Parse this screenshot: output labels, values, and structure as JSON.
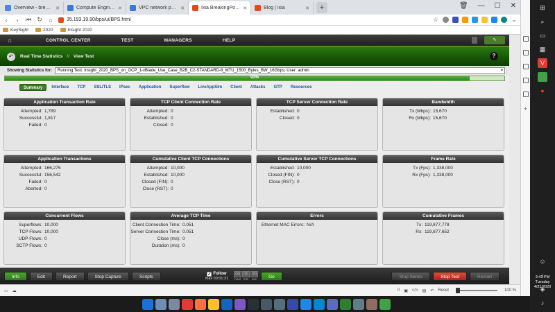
{
  "browser": {
    "tabs": [
      {
        "label": "Overview - breaking... - Dr",
        "color": "#4a86e8",
        "active": false
      },
      {
        "label": "Compute Engine - ixvm -",
        "color": "#3c78d8",
        "active": false
      },
      {
        "label": "VPC network peering - VP",
        "color": "#3c78d8",
        "active": false
      },
      {
        "label": "Ixia BreakingPoint - 35.19:",
        "color": "#e64a19",
        "active": true
      },
      {
        "label": "Blog | Ixia",
        "color": "#e64a19",
        "active": false
      }
    ],
    "new_tab": "+",
    "url": "35.193.19.90/bps/ui/BPS.html",
    "bookmarks": [
      "KeySight",
      "2020",
      "Insight 2020"
    ],
    "zoom": "100 %",
    "reset_label": "Reset"
  },
  "app": {
    "menu": [
      "CONTROL CENTER",
      "TEST",
      "MANAGERS",
      "HELP"
    ],
    "breadcrumb": {
      "section": "Real Time Statistics",
      "separator": "//",
      "page": "View Test"
    },
    "help_icon": "?",
    "stats_label": "Showing Statistics for:",
    "stats_value": "Running Test: Insight_2020_BPS_on_GCP_1-vBlade_Use_Case_B2B_C2-STANDARD-8_MTU_1500_Bytes_BW_16Gbps, User: admin",
    "progress": {
      "text": "93%",
      "value": 0.93
    },
    "subtabs": [
      "Summary",
      "Interface",
      "TCP",
      "SSL/TLS",
      "IPsec",
      "Application",
      "Superflow",
      "LiveAppSim",
      "Client",
      "Attacks",
      "GTP",
      "Resources"
    ],
    "cards": [
      {
        "title": "Application Transaction Rate",
        "rows": [
          {
            "k": "Attempted:",
            "v": "1,789"
          },
          {
            "k": "Successful:",
            "v": "1,817"
          },
          {
            "k": "Failed:",
            "v": "0"
          }
        ]
      },
      {
        "title": "TCP Client Connection Rate",
        "rows": [
          {
            "k": "Attempted:",
            "v": "0"
          },
          {
            "k": "Established:",
            "v": "0"
          },
          {
            "k": "Closed:",
            "v": "0"
          }
        ]
      },
      {
        "title": "TCP Server Connection Rate",
        "rows": [
          {
            "k": "Established:",
            "v": "0"
          },
          {
            "k": "Closed:",
            "v": "0"
          }
        ]
      },
      {
        "title": "Bandwidth",
        "rows": [
          {
            "k": "Tx (Mbps):",
            "v": "15,670"
          },
          {
            "k": "Rx (Mbps):",
            "v": "15,670"
          }
        ]
      },
      {
        "title": "Application Transactions",
        "rows": [
          {
            "k": "Attempted:",
            "v": "166,275"
          },
          {
            "k": "Successful:",
            "v": "156,542"
          },
          {
            "k": "Failed:",
            "v": "0"
          },
          {
            "k": "Aborted:",
            "v": "0"
          }
        ]
      },
      {
        "title": "Cumulative Client TCP Connections",
        "rows": [
          {
            "k": "Attempted:",
            "v": "10,000"
          },
          {
            "k": "Established:",
            "v": "10,000"
          },
          {
            "k": "Closed (FIN):",
            "v": "0"
          },
          {
            "k": "Close (RST):",
            "v": "0"
          }
        ]
      },
      {
        "title": "Cumulative Server TCP Connections",
        "rows": [
          {
            "k": "Established:",
            "v": "10,000"
          },
          {
            "k": "Closed (FIN):",
            "v": "0"
          },
          {
            "k": "Close (RST):",
            "v": "0"
          }
        ]
      },
      {
        "title": "Frame Rate",
        "rows": [
          {
            "k": "Tx (Fps):",
            "v": "1,338,000"
          },
          {
            "k": "Rx (Fps):",
            "v": "1,338,000"
          }
        ]
      },
      {
        "title": "Concurrent Flows",
        "rows": [
          {
            "k": "Superflows:",
            "v": "10,000"
          },
          {
            "k": "TCP Flows:",
            "v": "10,000"
          },
          {
            "k": "UDP Flows:",
            "v": "0"
          },
          {
            "k": "SCTP Flows:",
            "v": "0"
          }
        ]
      },
      {
        "title": "Average TCP Time",
        "rows": [
          {
            "k": "Client Connection Time:",
            "v": "0.051"
          },
          {
            "k": "Server Connection Time:",
            "v": "0.051"
          },
          {
            "k": "Close (ms):",
            "v": "0"
          },
          {
            "k": "Duration (ms):",
            "v": "0"
          }
        ]
      },
      {
        "title": "Errors",
        "rows": [
          {
            "k": "Ethernet MAC Errors:",
            "v": "N/A"
          }
        ]
      },
      {
        "title": "Cumulative Frames",
        "rows": [
          {
            "k": "Tx:",
            "v": "119,877,778"
          },
          {
            "k": "Rx:",
            "v": "119,877,652"
          }
        ]
      }
    ],
    "bottom": {
      "info": "Info",
      "edit": "Edit",
      "report": "Report",
      "stop_capture": "Stop Capture",
      "scripts": "Scripts",
      "follow": "Follow",
      "follow_sub": "max 00:01:31",
      "time_fields": [
        {
          "val": "00",
          "cap": "hour"
        },
        {
          "val": "00",
          "cap": "min"
        },
        {
          "val": "00",
          "cap": "sec"
        }
      ],
      "go": "Go",
      "stop_series": "Stop Series",
      "stop_test": "Stop Test",
      "restart": "Restart"
    }
  },
  "os": {
    "time": "3:41 PM",
    "day": "Tuesday",
    "date": "4/21/2020"
  }
}
